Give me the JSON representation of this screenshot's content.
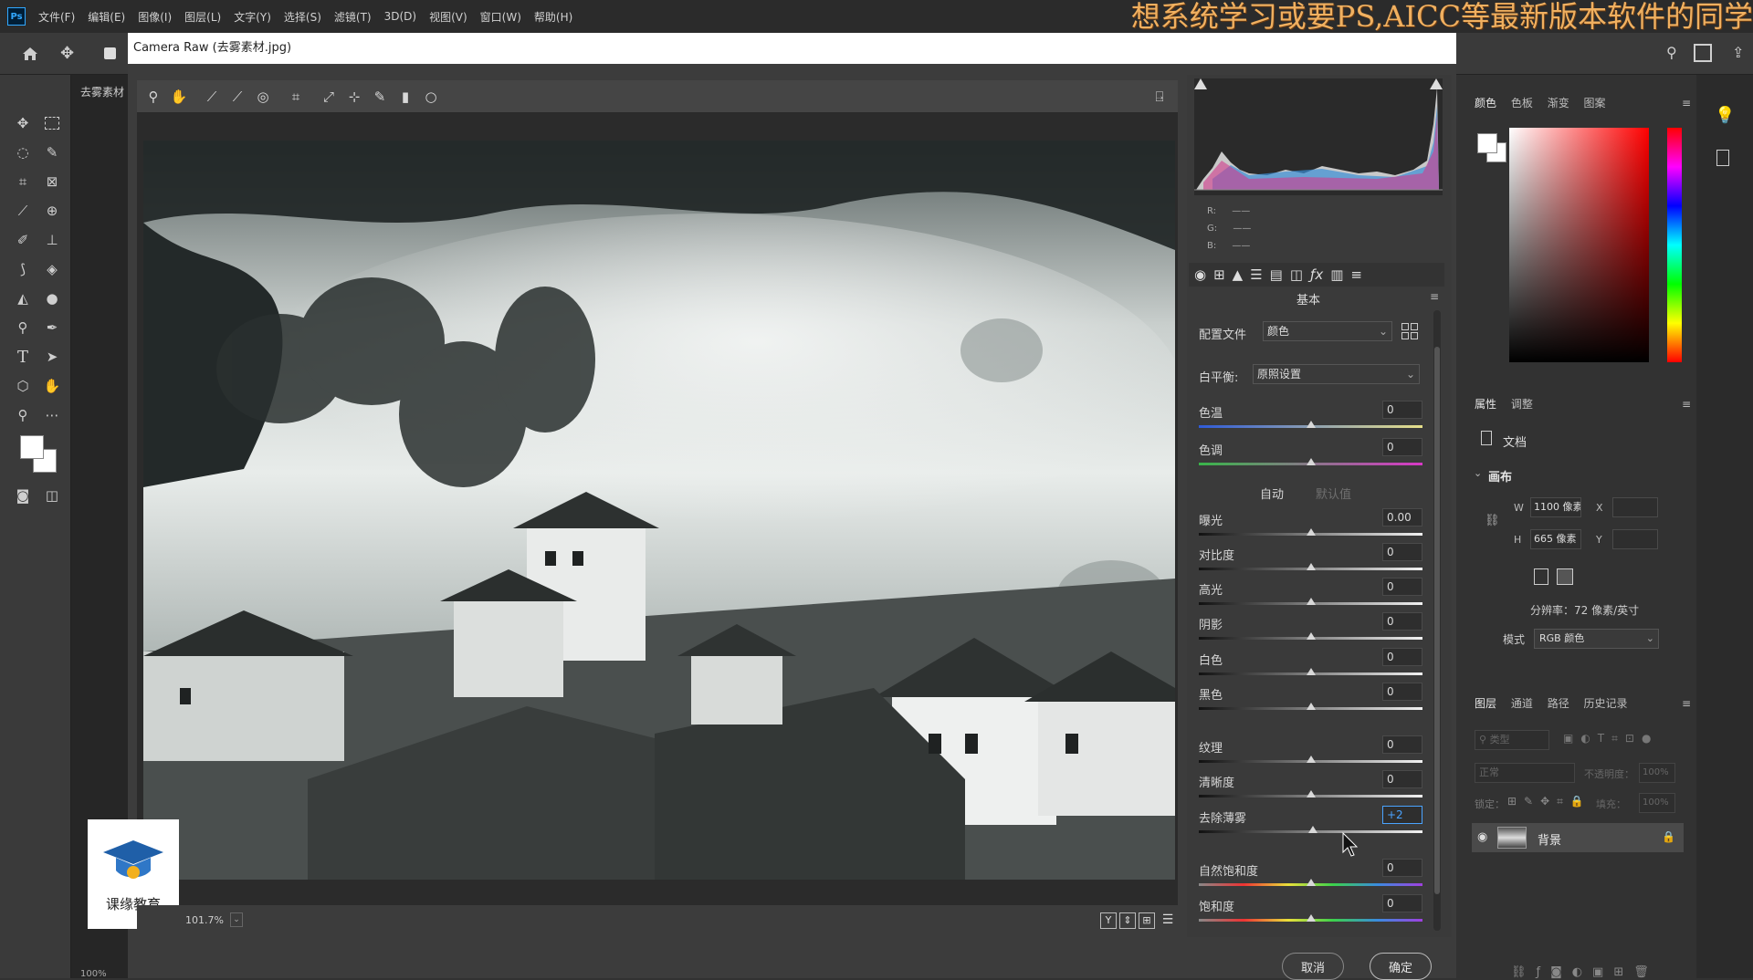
{
  "menubar": {
    "logo": "Ps",
    "items": [
      "文件(F)",
      "编辑(E)",
      "图像(I)",
      "图层(L)",
      "文字(Y)",
      "选择(S)",
      "滤镜(T)",
      "3D(D)",
      "视图(V)",
      "窗口(W)",
      "帮助(H)"
    ],
    "banner": "想系统学习或要PS,AICC等最新版本软件的同学"
  },
  "camera_raw": {
    "title": "Camera Raw (去雾素材.jpg)",
    "zoom": "101.7%",
    "buttons": {
      "cancel": "取消",
      "ok": "确定"
    }
  },
  "doc": {
    "tab_label": "去雾素材",
    "zoom_bottom": "100%"
  },
  "histogram": {
    "r_label": "R:",
    "g_label": "G:",
    "b_label": "B:",
    "r_value": "——",
    "g_value": "——",
    "b_value": "——"
  },
  "basic_panel": {
    "title": "基本",
    "profile_label": "配置文件",
    "profile_value": "颜色",
    "wb_label": "白平衡:",
    "wb_value": "原照设置",
    "auto_label": "自动",
    "default_label": "默认值",
    "sliders": [
      {
        "label": "色温",
        "value": "0",
        "pos": 0.5,
        "track": "temp"
      },
      {
        "label": "色调",
        "value": "0",
        "pos": 0.5,
        "track": "tint"
      },
      {
        "label": "曝光",
        "value": "0.00",
        "pos": 0.5,
        "track": "gray"
      },
      {
        "label": "对比度",
        "value": "0",
        "pos": 0.5,
        "track": "gray"
      },
      {
        "label": "高光",
        "value": "0",
        "pos": 0.5,
        "track": "gray"
      },
      {
        "label": "阴影",
        "value": "0",
        "pos": 0.5,
        "track": "gray"
      },
      {
        "label": "白色",
        "value": "0",
        "pos": 0.5,
        "track": "gray"
      },
      {
        "label": "黑色",
        "value": "0",
        "pos": 0.5,
        "track": "gray"
      },
      {
        "label": "纹理",
        "value": "0",
        "pos": 0.5,
        "track": "gray"
      },
      {
        "label": "清晰度",
        "value": "0",
        "pos": 0.5,
        "track": "gray"
      },
      {
        "label": "去除薄雾",
        "value": "+2",
        "pos": 0.51,
        "track": "gray",
        "active": true
      },
      {
        "label": "自然饱和度",
        "value": "0",
        "pos": 0.5,
        "track": "sat"
      },
      {
        "label": "饱和度",
        "value": "0",
        "pos": 0.5,
        "track": "sat"
      }
    ]
  },
  "color_panel": {
    "tabs": [
      "颜色",
      "色板",
      "渐变",
      "图案"
    ]
  },
  "properties_panel": {
    "tabs": [
      "属性",
      "调整"
    ],
    "doc_label": "文档",
    "canvas_label": "画布",
    "w_label": "W",
    "w_value": "1100 像素",
    "h_label": "H",
    "h_value": "665 像素",
    "x_label": "X",
    "y_label": "Y",
    "resolution": "分辨率：72 像素/英寸",
    "mode_label": "模式",
    "mode_value": "RGB 颜色"
  },
  "layers_panel": {
    "tabs": [
      "图层",
      "通道",
      "路径",
      "历史记录"
    ],
    "search_placeholder": "类型",
    "blend_mode": "正常",
    "opacity_label": "不透明度：",
    "opacity_value": "100%",
    "lock_label": "锁定：",
    "fill_label": "填充：",
    "fill_value": "100%",
    "layer_name": "背景"
  },
  "watermark": {
    "text": "课缘教育"
  },
  "colors": {
    "accent": "#31a8ff",
    "banner": "#f0b060"
  }
}
